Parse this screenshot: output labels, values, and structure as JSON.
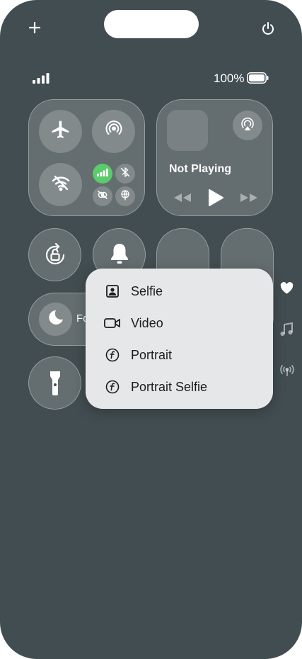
{
  "status": {
    "battery_text": "100%"
  },
  "media": {
    "now_playing": "Not Playing"
  },
  "focus": {
    "label": "Fo"
  },
  "menu": {
    "items": [
      {
        "label": "Selfie",
        "icon": "portrait-square-icon"
      },
      {
        "label": "Video",
        "icon": "video-camera-icon"
      },
      {
        "label": "Portrait",
        "icon": "f-circle-icon"
      },
      {
        "label": "Portrait Selfie",
        "icon": "f-circle-icon"
      }
    ]
  },
  "colors": {
    "background": "#424d51",
    "cellular_active": "#5bcb6b",
    "menu_bg": "#e6e7e9"
  }
}
